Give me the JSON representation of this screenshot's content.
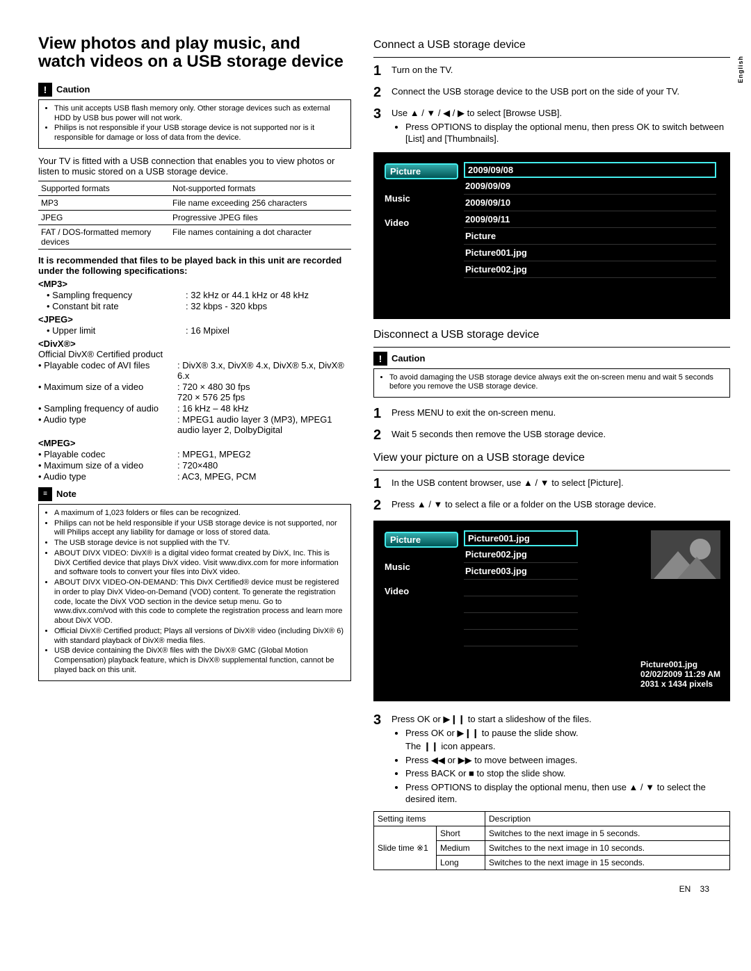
{
  "lang_tab": "English",
  "left": {
    "title": "View photos and play music, and watch videos on a USB storage device",
    "caution_label": "Caution",
    "caution_items": [
      "This unit accepts USB flash memory only. Other storage devices such as external HDD by USB bus power will not work.",
      "Philips is not responsible if your USB storage device is not supported nor is it responsible for damage or loss of data from the device."
    ],
    "intro": "Your TV is fitted with a USB connection that enables you to view photos or listen to music stored on a USB storage device.",
    "fmt_header1": "Supported formats",
    "fmt_header2": "Not-supported formats",
    "fmt_rows": [
      [
        "MP3",
        "File name exceeding 256 characters"
      ],
      [
        "JPEG",
        "Progressive JPEG files"
      ],
      [
        "FAT / DOS-formatted memory devices",
        "File names containing a dot character"
      ]
    ],
    "rec_intro": "It is recommended that files to be played back in this unit are recorded under the following specifications:",
    "mp3_hdr": "<MP3>",
    "mp3_rows": [
      [
        "Sampling frequency",
        "32 kHz or 44.1 kHz or 48 kHz"
      ],
      [
        "Constant bit rate",
        "32 kbps - 320 kbps"
      ]
    ],
    "jpeg_hdr": "<JPEG>",
    "jpeg_rows": [
      [
        "Upper limit",
        "16 Mpixel"
      ]
    ],
    "divx_hdr": "<DivX®>",
    "divx_line": "Official DivX® Certified product",
    "divx_rows": [
      [
        "Playable codec of AVI files",
        "DivX® 3.x, DivX® 4.x, DivX® 5.x, DivX® 6.x"
      ],
      [
        "Maximum size of a video",
        "720 × 480 30 fps\n720 × 576 25 fps"
      ],
      [
        "Sampling frequency of audio",
        "16 kHz – 48 kHz"
      ],
      [
        "Audio type",
        "MPEG1 audio layer 3 (MP3), MPEG1 audio layer 2, DolbyDigital"
      ]
    ],
    "mpeg_hdr": "<MPEG>",
    "mpeg_rows": [
      [
        "Playable codec",
        "MPEG1, MPEG2"
      ],
      [
        "Maximum size of a video",
        "720×480"
      ],
      [
        "Audio type",
        "AC3, MPEG, PCM"
      ]
    ],
    "note_label": "Note",
    "note_items": [
      "A maximum of 1,023 folders or files can be recognized.",
      "Philips can not be held responsible if your USB storage device is not supported, nor will Philips accept any liability for damage or loss of stored data.",
      "The USB storage device is not supplied with the TV.",
      "ABOUT DIVX VIDEO: DivX® is a digital video format created by DivX, Inc. This is DivX Certified device that plays DivX video. Visit www.divx.com for more information and software tools to convert your files into DivX video.",
      "ABOUT DIVX VIDEO-ON-DEMAND: This DivX Certified® device must be registered in order to play DivX Video-on-Demand (VOD) content. To generate the registration code, locate the DivX VOD section in the device setup menu. Go to www.divx.com/vod with this code to complete the registration process and learn more about DivX VOD.",
      "Official DivX® Certified product; Plays all versions of DivX® video (including DivX® 6) with standard playback of DivX® media files.",
      "USB device containing the DivX® files with the DivX® GMC (Global Motion Compensation) playback feature, which is DivX® supplemental function, cannot be played back on this unit."
    ]
  },
  "right": {
    "connect_hdr": "Connect a USB storage device",
    "connect_steps": [
      "Turn on the TV.",
      "Connect the USB storage device to the USB port on the side of your TV.",
      "Use ▲ / ▼ / ◀ / ▶ to select [Browse USB]."
    ],
    "connect_sub": "Press OPTIONS to display the optional menu, then press OK to switch between [List] and [Thumbnails].",
    "tv1_left": [
      "Picture",
      "Music",
      "Video"
    ],
    "tv1_right": [
      "2009/09/08",
      "2009/09/09",
      "2009/09/10",
      "2009/09/11",
      "Picture",
      "Picture001.jpg",
      "Picture002.jpg"
    ],
    "disconnect_hdr": "Disconnect a USB storage device",
    "disconnect_caution_label": "Caution",
    "disconnect_caution": "To avoid damaging the USB storage device always exit the on-screen menu and wait 5 seconds before you remove the USB storage device.",
    "disconnect_steps": [
      "Press MENU to exit the on-screen menu.",
      "Wait 5 seconds then remove the USB storage device."
    ],
    "view_hdr": "View your picture on a USB storage device",
    "view_steps12": [
      "In the USB content browser, use ▲ / ▼ to select [Picture].",
      "Press ▲ / ▼ to select a file or a folder on the USB storage device."
    ],
    "tv2_left": [
      "Picture",
      "Music",
      "Video"
    ],
    "tv2_right": [
      "Picture001.jpg",
      "Picture002.jpg",
      "Picture003.jpg"
    ],
    "tv2_info": [
      "Picture001.jpg",
      "02/02/2009 11:29 AM",
      "2031 x 1434 pixels"
    ],
    "view_step3": "Press OK or ▶❙❙ to start a slideshow of the files.",
    "view_subs": [
      "Press OK or ▶❙❙ to pause the slide show.",
      "The ❙❙ icon appears.",
      "Press ◀◀ or ▶▶ to move between images.",
      "Press BACK or ■ to stop the slide show.",
      "Press OPTIONS to display the optional menu, then use ▲ / ▼ to select the desired item."
    ],
    "settings_hdr": [
      "Setting items",
      "",
      "Description"
    ],
    "settings_rowlabel": "Slide time ※1",
    "settings_rows": [
      [
        "Short",
        "Switches to the next image in 5 seconds."
      ],
      [
        "Medium",
        "Switches to the next image in 10 seconds."
      ],
      [
        "Long",
        "Switches to the next image in 15 seconds."
      ]
    ]
  },
  "footer": {
    "lang": "EN",
    "page": "33"
  }
}
